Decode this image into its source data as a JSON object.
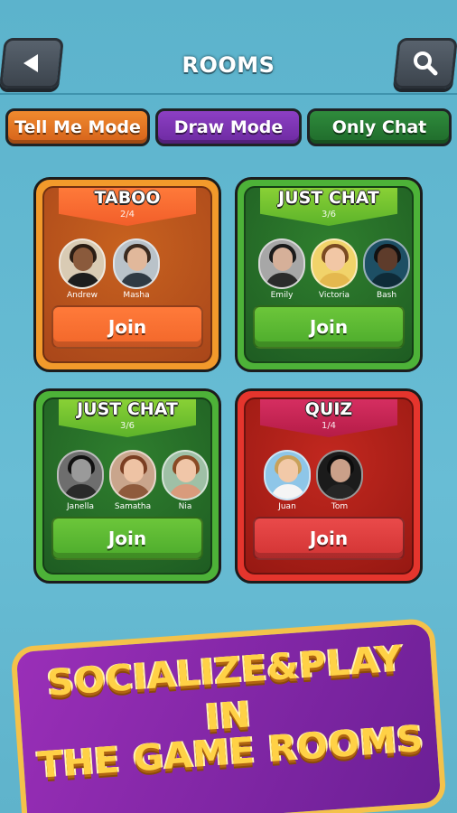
{
  "header": {
    "title": "ROOMS",
    "back_icon": "back-arrow-icon",
    "search_icon": "search-icon"
  },
  "tabs": [
    {
      "label": "Tell Me Mode",
      "color": "#e9782a"
    },
    {
      "label": "Draw Mode",
      "color": "#7b34b3"
    },
    {
      "label": "Only Chat",
      "color": "#27803a"
    }
  ],
  "rooms": [
    {
      "title": "TABOO",
      "count": "2/4",
      "theme": "orange",
      "join_label": "Join",
      "players": [
        {
          "name": "Andrew"
        },
        {
          "name": "Masha"
        }
      ]
    },
    {
      "title": "JUST CHAT",
      "count": "3/6",
      "theme": "green",
      "join_label": "Join",
      "players": [
        {
          "name": "Emily"
        },
        {
          "name": "Victoria"
        },
        {
          "name": "Bash"
        }
      ]
    },
    {
      "title": "JUST CHAT",
      "count": "3/6",
      "theme": "green",
      "join_label": "Join",
      "players": [
        {
          "name": "Janella"
        },
        {
          "name": "Samatha"
        },
        {
          "name": "Nia"
        }
      ]
    },
    {
      "title": "QUIZ",
      "count": "1/4",
      "theme": "red",
      "join_label": "Join",
      "players": [
        {
          "name": "Juan"
        },
        {
          "name": "Tom"
        }
      ]
    }
  ],
  "banner": {
    "line1": "SOCIALIZE&PLAY",
    "line2": "IN",
    "line3": "THE GAME ROOMS"
  }
}
